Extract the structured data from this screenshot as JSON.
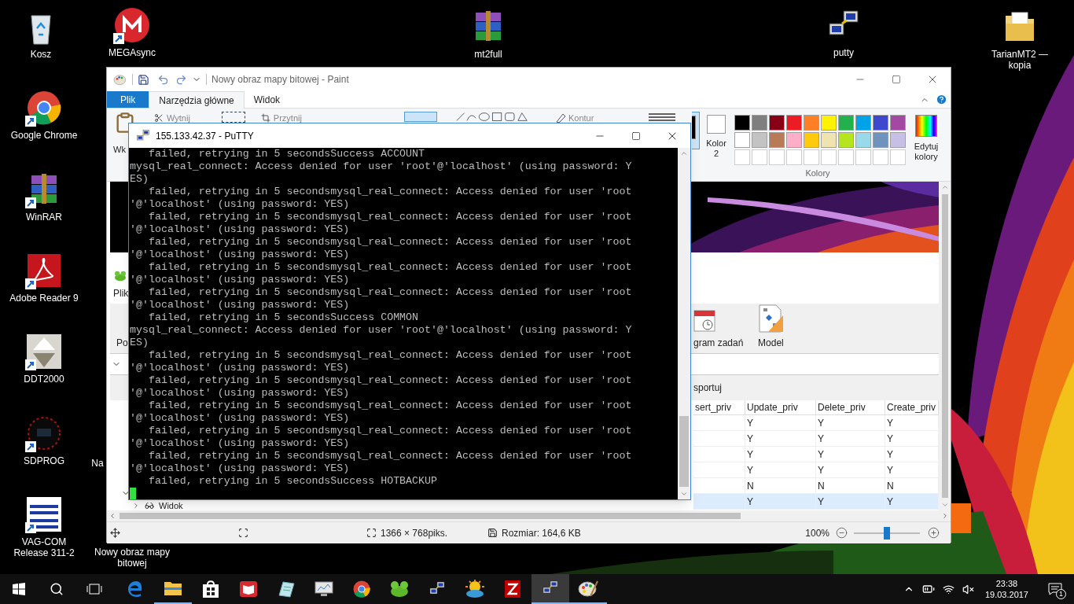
{
  "desktop_icons": [
    {
      "kind": "recycle-bin",
      "label": "Kosz",
      "shortcut": false
    },
    {
      "kind": "mega",
      "label": "MEGAsync",
      "shortcut": true
    },
    {
      "kind": "chrome",
      "label": "Google Chrome",
      "shortcut": true
    },
    {
      "kind": "archive",
      "label": "WinRAR",
      "shortcut": true
    },
    {
      "kind": "reader",
      "label": "Adobe Reader 9",
      "shortcut": true
    },
    {
      "kind": "ddt",
      "label": "DDT2000",
      "shortcut": true
    },
    {
      "kind": "sdprog",
      "label": "SDPROG",
      "shortcut": true
    },
    {
      "kind": "vag",
      "label": "VAG-COM Release 311-2",
      "shortcut": true
    },
    {
      "kind": "archive",
      "label": "mt2full",
      "shortcut": false
    },
    {
      "kind": "putty",
      "label": "putty",
      "shortcut": false
    },
    {
      "kind": "folder",
      "label": "TarianMT2 — kopia",
      "shortcut": false
    },
    {
      "kind": "hidden",
      "label": "Na"
    },
    {
      "kind": "hidden",
      "label": "Nowy obraz mapy bitowej"
    }
  ],
  "paint": {
    "title": "Nowy obraz mapy bitowej - Paint",
    "tabs": [
      {
        "label": "Plik",
        "selected": false,
        "kind": "file"
      },
      {
        "label": "Narzędzia główne",
        "selected": true,
        "kind": "tab"
      },
      {
        "label": "Widok",
        "selected": false,
        "kind": "tab"
      }
    ],
    "ribbon": {
      "paste": "Wk",
      "cut": "Wytnij",
      "crop": "Przytnij",
      "outline": "Kontur",
      "color_1": {
        "color": "#000000",
        "selected": true
      },
      "color_2": {
        "label": "Kolor 2",
        "color": "#ffffff",
        "selected": false
      },
      "palette": [
        {
          "color": "#000000"
        },
        {
          "color": "#7f7f7f"
        },
        {
          "color": "#880015"
        },
        {
          "color": "#ed1c24"
        },
        {
          "color": "#ff7f27"
        },
        {
          "color": "#fff200"
        },
        {
          "color": "#22b14c"
        },
        {
          "color": "#00a2e8"
        },
        {
          "color": "#3f48cc"
        },
        {
          "color": "#a349a4"
        },
        {
          "color": "#ffffff"
        },
        {
          "color": "#c3c3c3"
        },
        {
          "color": "#b97a57"
        },
        {
          "color": "#ffaec9"
        },
        {
          "color": "#ffc90e"
        },
        {
          "color": "#efe4b0"
        },
        {
          "color": "#b5e61d"
        },
        {
          "color": "#99d9ea"
        },
        {
          "color": "#7092be"
        },
        {
          "color": "#c8bfe7"
        }
      ],
      "edit_colors": "Edytuj kolory",
      "group_label": "Kolory"
    },
    "canvas": {
      "menu_tab": "Plik",
      "toolbar_left": "Po",
      "toolbar_items": [
        {
          "kind": "schedule",
          "label": "gram zadań"
        },
        {
          "kind": "model",
          "label": "Model"
        }
      ],
      "export": "sportuj",
      "tree_item": "Widok",
      "table": {
        "columns": [
          "sert_priv",
          "Update_priv",
          "Delete_priv",
          "Create_priv"
        ],
        "rows": [
          {
            "cells": [
              "",
              "Y",
              "Y",
              "Y"
            ],
            "selected": false
          },
          {
            "cells": [
              "",
              "Y",
              "Y",
              "Y"
            ],
            "selected": false
          },
          {
            "cells": [
              "",
              "Y",
              "Y",
              "Y"
            ],
            "selected": false
          },
          {
            "cells": [
              "",
              "Y",
              "Y",
              "Y"
            ],
            "selected": false
          },
          {
            "cells": [
              "",
              "N",
              "N",
              "N"
            ],
            "selected": false
          },
          {
            "cells": [
              "",
              "Y",
              "Y",
              "Y"
            ],
            "selected": true
          }
        ]
      }
    },
    "status": {
      "dimensions": "1366 × 768piks.",
      "size": "Rozmiar: 164,6 KB",
      "zoom": "100%",
      "zoom_slider": {
        "level": 0.5
      }
    }
  },
  "putty": {
    "title": "155.133.42.37 - PuTTY",
    "lines": [
      "   failed, retrying in 5 secondsSuccess ACCOUNT",
      "mysql_real_connect: Access denied for user 'root'@'localhost' (using password: Y",
      "ES)",
      "   failed, retrying in 5 secondsmysql_real_connect: Access denied for user 'root",
      "'@'localhost' (using password: YES)",
      "   failed, retrying in 5 secondsmysql_real_connect: Access denied for user 'root",
      "'@'localhost' (using password: YES)",
      "   failed, retrying in 5 secondsmysql_real_connect: Access denied for user 'root",
      "'@'localhost' (using password: YES)",
      "   failed, retrying in 5 secondsmysql_real_connect: Access denied for user 'root",
      "'@'localhost' (using password: YES)",
      "   failed, retrying in 5 secondsmysql_real_connect: Access denied for user 'root",
      "'@'localhost' (using password: YES)",
      "   failed, retrying in 5 secondsSuccess COMMON",
      "mysql_real_connect: Access denied for user 'root'@'localhost' (using password: Y",
      "ES)",
      "   failed, retrying in 5 secondsmysql_real_connect: Access denied for user 'root",
      "'@'localhost' (using password: YES)",
      "   failed, retrying in 5 secondsmysql_real_connect: Access denied for user 'root",
      "'@'localhost' (using password: YES)",
      "   failed, retrying in 5 secondsmysql_real_connect: Access denied for user 'root",
      "'@'localhost' (using password: YES)",
      "   failed, retrying in 5 secondsmysql_real_connect: Access denied for user 'root",
      "'@'localhost' (using password: YES)",
      "   failed, retrying in 5 secondsmysql_real_connect: Access denied for user 'root",
      "'@'localhost' (using password: YES)",
      "   failed, retrying in 5 secondsSuccess HOTBACKUP"
    ]
  },
  "taskbar": {
    "apps": [
      {
        "kind": "start",
        "running": false,
        "active": false
      },
      {
        "kind": "search",
        "running": false,
        "active": false
      },
      {
        "kind": "task-view",
        "running": false,
        "active": false
      },
      {
        "kind": "edge",
        "running": false,
        "active": false
      },
      {
        "kind": "explorer",
        "running": true,
        "active": false
      },
      {
        "kind": "store",
        "running": false,
        "active": false
      },
      {
        "kind": "book",
        "running": false,
        "active": false
      },
      {
        "kind": "notepad",
        "running": false,
        "active": false
      },
      {
        "kind": "monitor",
        "running": false,
        "active": false
      },
      {
        "kind": "chrome",
        "running": false,
        "active": false
      },
      {
        "kind": "frog",
        "running": false,
        "active": false
      },
      {
        "kind": "putty",
        "running": false,
        "active": false
      },
      {
        "kind": "weather",
        "running": false,
        "active": false
      },
      {
        "kind": "filezilla",
        "running": false,
        "active": false
      },
      {
        "kind": "putty",
        "running": true,
        "active": true
      },
      {
        "kind": "paint",
        "running": true,
        "active": false
      }
    ],
    "time": "23:38",
    "date": "19.03.2017",
    "notifications": "1"
  }
}
